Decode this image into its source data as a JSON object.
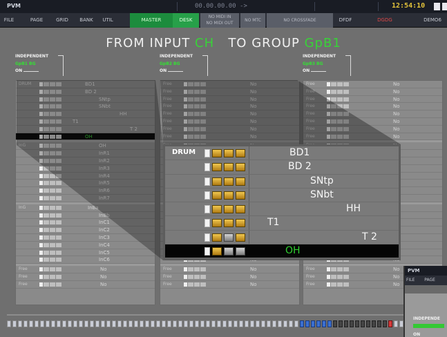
{
  "titlebar": {
    "app": "PVM",
    "timecode": "00.00.00.00  ->",
    "clock": "12:54:10"
  },
  "menu": {
    "file": "FILE",
    "page": "PAGE",
    "grid": "GRID",
    "bank": "BANK",
    "util": "UTIL",
    "master": "MASTER",
    "desk": "DESK",
    "midi": [
      "NO MIDI IN",
      "NO MIDI OUT"
    ],
    "mtc": "NO MTC",
    "crossfade": "NO CROSSFADE",
    "dfdf": "DFDF",
    "dgdg": "DGDG",
    "demo": "DEMO6"
  },
  "heading": {
    "from": "FROM INPUT",
    "input": "CH",
    "to": "TO GROUP",
    "group": "GpB1"
  },
  "columns": [
    {
      "independent": "INDEPENDENT",
      "group_label": "GpB1 BG",
      "on": "ON",
      "rows": [
        {
          "label": "DRUM",
          "name": "BD1",
          "offset": 0
        },
        {
          "label": "",
          "name": "BD 2",
          "offset": 0
        },
        {
          "label": "",
          "name": "SNtp",
          "offset": 20
        },
        {
          "label": "",
          "name": "SNbt",
          "offset": 20
        },
        {
          "label": "",
          "name": "HH",
          "offset": 50
        },
        {
          "label": "",
          "name": "T1",
          "offset": -18
        },
        {
          "label": "",
          "name": "T 2",
          "offset": 65
        },
        {
          "label": "",
          "name": "OH",
          "offset": 0,
          "selected": true
        },
        {
          "label": "InG",
          "name": "OH",
          "offset": 20
        },
        {
          "label": "",
          "name": "InR1",
          "offset": 20
        },
        {
          "label": "",
          "name": "InR2",
          "offset": 20
        },
        {
          "label": "",
          "name": "InR3",
          "offset": 20
        },
        {
          "label": "",
          "name": "InR4",
          "offset": 20
        },
        {
          "label": "",
          "name": "InR5",
          "offset": 20
        },
        {
          "label": "",
          "name": "InR6",
          "offset": 20
        },
        {
          "label": "",
          "name": "InR7",
          "offset": 20
        },
        {
          "label": "InG",
          "name": "InBa",
          "offset": 4
        },
        {
          "label": "",
          "name": "InBb",
          "offset": 20
        },
        {
          "label": "",
          "name": "InC1",
          "offset": 20
        },
        {
          "label": "",
          "name": "InC2",
          "offset": 20
        },
        {
          "label": "",
          "name": "InC3",
          "offset": 20
        },
        {
          "label": "",
          "name": "InC4",
          "offset": 20
        },
        {
          "label": "",
          "name": "InC5",
          "offset": 20
        },
        {
          "label": "",
          "name": "InC6",
          "offset": 20
        },
        {
          "label": "Free",
          "name": "No",
          "offset": 22
        },
        {
          "label": "Free",
          "name": "No",
          "offset": 22
        },
        {
          "label": "Free",
          "name": "No",
          "offset": 22
        }
      ]
    },
    {
      "independent": "INDEPENDENT",
      "group_label": "GpB2 BG",
      "on": "ON",
      "free": "Free",
      "no": "No"
    },
    {
      "independent": "INDEPENDENT",
      "group_label": "GpB3 BG",
      "on": "ON",
      "free": "Free",
      "no": "No"
    }
  ],
  "zoom": {
    "group": "DRUM",
    "rows": [
      {
        "name": "BD1",
        "pos": 180,
        "buttons": "ggg"
      },
      {
        "name": "BD 2",
        "pos": 178,
        "buttons": "ggg"
      },
      {
        "name": "SNtp",
        "pos": 210,
        "buttons": "ggg"
      },
      {
        "name": "SNbt",
        "pos": 210,
        "buttons": "ggg"
      },
      {
        "name": "HH",
        "pos": 262,
        "buttons": "ggg"
      },
      {
        "name": "T1",
        "pos": 148,
        "buttons": "ggg"
      },
      {
        "name": "T 2",
        "pos": 285,
        "buttons": "gGg"
      },
      {
        "name": "OH",
        "pos": 174,
        "buttons": "gGG",
        "selected": true
      }
    ]
  },
  "mini": {
    "app": "PVM",
    "file": "FILE",
    "page": "PAGE",
    "independent": "INDEPENDE",
    "on": "ON"
  },
  "colors": {
    "accent_green": "#36c436",
    "master_green": "#1c8c3d",
    "selected_row": "#0d0d0d",
    "button_gold": "#f1c850"
  },
  "counts": {
    "column_rows": 27,
    "bottom_strip": 72
  }
}
